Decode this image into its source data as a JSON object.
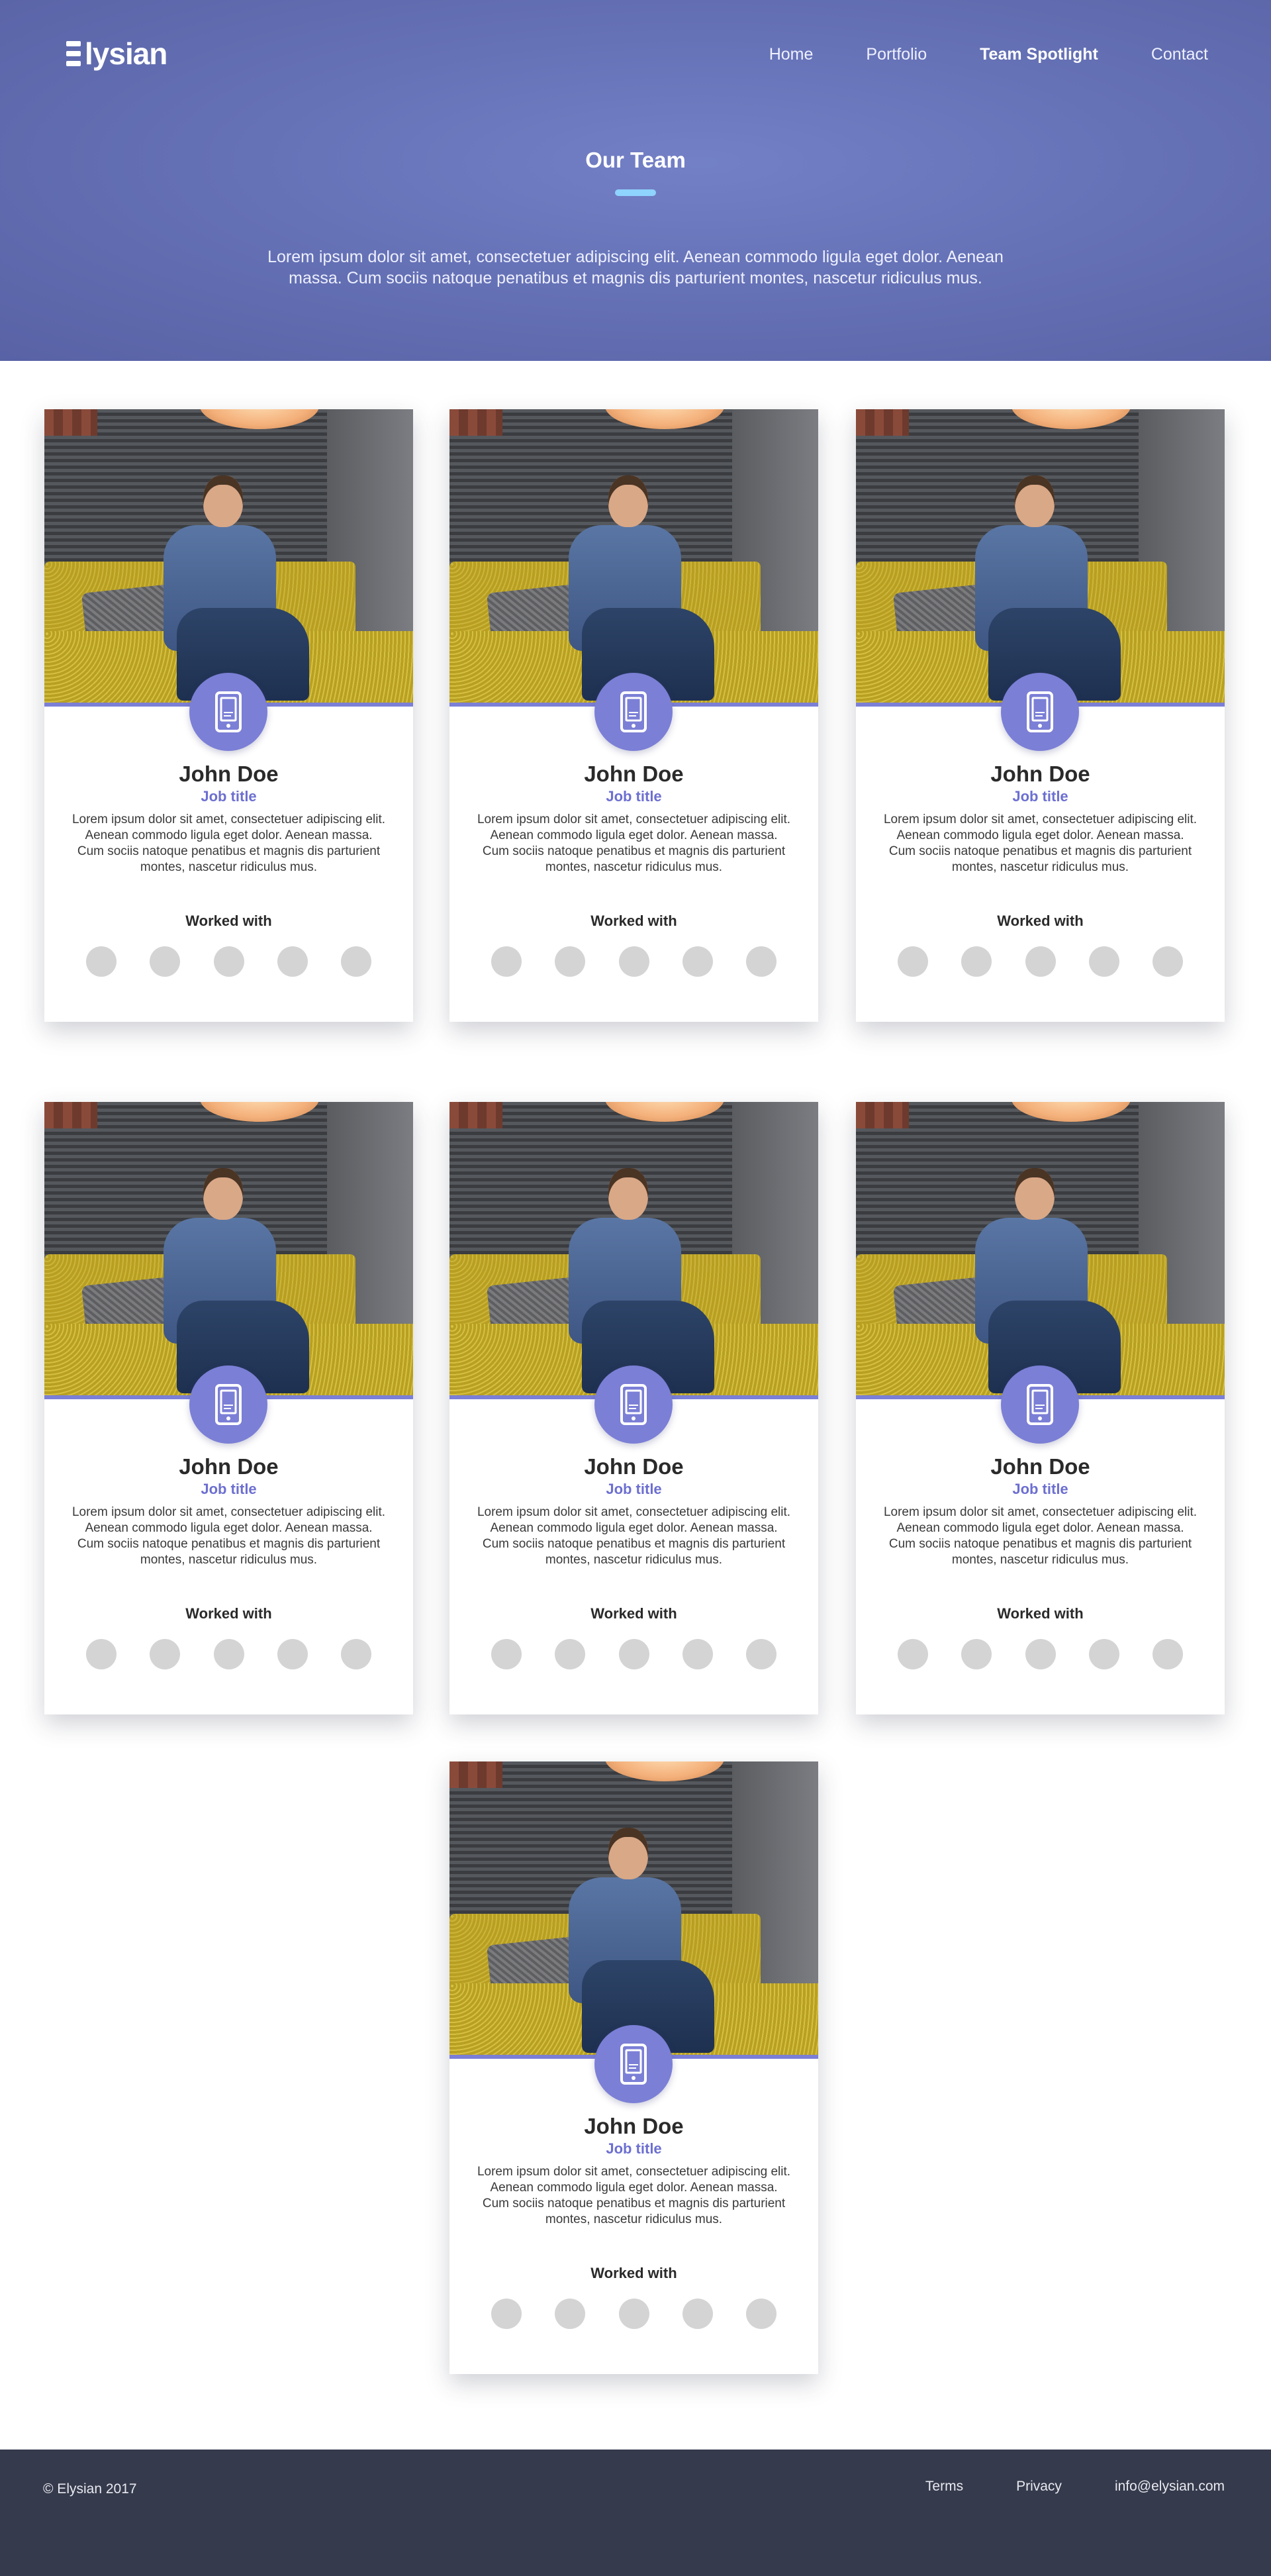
{
  "header": {
    "logo": "Elysian",
    "nav": [
      {
        "label": "Home",
        "active": false
      },
      {
        "label": "Portfolio",
        "active": false
      },
      {
        "label": "Team Spotlight",
        "active": true
      },
      {
        "label": "Contact",
        "active": false
      }
    ]
  },
  "hero": {
    "title": "Our Team",
    "description": "Lorem ipsum dolor sit amet, consectetuer adipiscing elit. Aenean commodo ligula eget dolor. Aenean massa. Cum sociis natoque penatibus et magnis dis parturient montes, nascetur ridiculus mus."
  },
  "team": [
    {
      "name": "John Doe",
      "job_title": "Job title",
      "bio": "Lorem ipsum dolor sit amet, consectetuer adipiscing elit. Aenean commodo ligula eget dolor. Aenean massa. Cum sociis natoque penatibus et magnis dis parturient montes, nascetur ridiculus mus.",
      "worked_with_label": "Worked with",
      "badge_icon": "smartphone-icon"
    },
    {
      "name": "John Doe",
      "job_title": "Job title",
      "bio": "Lorem ipsum dolor sit amet, consectetuer adipiscing elit. Aenean commodo ligula eget dolor. Aenean massa. Cum sociis natoque penatibus et magnis dis parturient montes, nascetur ridiculus mus.",
      "worked_with_label": "Worked with",
      "badge_icon": "smartphone-icon"
    },
    {
      "name": "John Doe",
      "job_title": "Job title",
      "bio": "Lorem ipsum dolor sit amet, consectetuer adipiscing elit. Aenean commodo ligula eget dolor. Aenean massa. Cum sociis natoque penatibus et magnis dis parturient montes, nascetur ridiculus mus.",
      "worked_with_label": "Worked with",
      "badge_icon": "smartphone-icon"
    },
    {
      "name": "John Doe",
      "job_title": "Job title",
      "bio": "Lorem ipsum dolor sit amet, consectetuer adipiscing elit. Aenean commodo ligula eget dolor. Aenean massa. Cum sociis natoque penatibus et magnis dis parturient montes, nascetur ridiculus mus.",
      "worked_with_label": "Worked with",
      "badge_icon": "smartphone-icon"
    },
    {
      "name": "John Doe",
      "job_title": "Job title",
      "bio": "Lorem ipsum dolor sit amet, consectetuer adipiscing elit. Aenean commodo ligula eget dolor. Aenean massa. Cum sociis natoque penatibus et magnis dis parturient montes, nascetur ridiculus mus.",
      "worked_with_label": "Worked with",
      "badge_icon": "smartphone-icon"
    },
    {
      "name": "John Doe",
      "job_title": "Job title",
      "bio": "Lorem ipsum dolor sit amet, consectetuer adipiscing elit. Aenean commodo ligula eget dolor. Aenean massa. Cum sociis natoque penatibus et magnis dis parturient montes, nascetur ridiculus mus.",
      "worked_with_label": "Worked with",
      "badge_icon": "smartphone-icon"
    },
    {
      "name": "John Doe",
      "job_title": "Job title",
      "bio": "Lorem ipsum dolor sit amet, consectetuer adipiscing elit. Aenean commodo ligula eget dolor. Aenean massa. Cum sociis natoque penatibus et magnis dis parturient montes, nascetur ridiculus mus.",
      "worked_with_label": "Worked with",
      "badge_icon": "smartphone-icon"
    }
  ],
  "footer": {
    "copyright": "© Elysian 2017",
    "links": [
      "Terms",
      "Privacy",
      "info@elysian.com"
    ]
  },
  "colors": {
    "hero_gradient": "#6672b6",
    "accent": "#7b7fd6",
    "job_title": "#6c6fd0",
    "footer_bg": "#353a4c"
  }
}
